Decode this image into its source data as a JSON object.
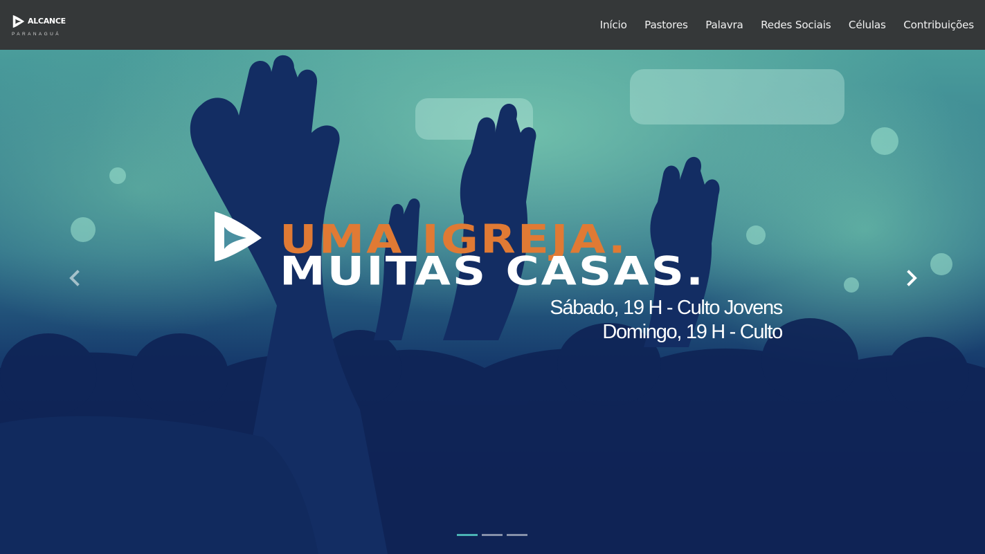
{
  "brand": {
    "name": "ALCANCE",
    "subtitle": "PARANAGUÁ"
  },
  "nav": {
    "items": [
      {
        "label": "Início"
      },
      {
        "label": "Pastores"
      },
      {
        "label": "Palavra"
      },
      {
        "label": "Redes Sociais"
      },
      {
        "label": "Células"
      },
      {
        "label": "Contribuições"
      }
    ]
  },
  "hero": {
    "headline_line1": "UMA IGREJA.",
    "headline_line2": "MUITAS CASAS.",
    "schedule": [
      "Sábado, 19 H - Culto Jovens",
      "Domingo, 19 H - Culto"
    ],
    "controls": {
      "prev_icon": "chevron-left-icon",
      "next_icon": "chevron-right-icon"
    },
    "indicators": {
      "count": 3,
      "active": 1
    }
  },
  "colors": {
    "navbar_bg": "#353839",
    "accent_orange": "#e07a34",
    "hero_navy": "#0f2456",
    "hero_teal": "#4a9d9b",
    "indicator_active": "#4bb3b5"
  }
}
